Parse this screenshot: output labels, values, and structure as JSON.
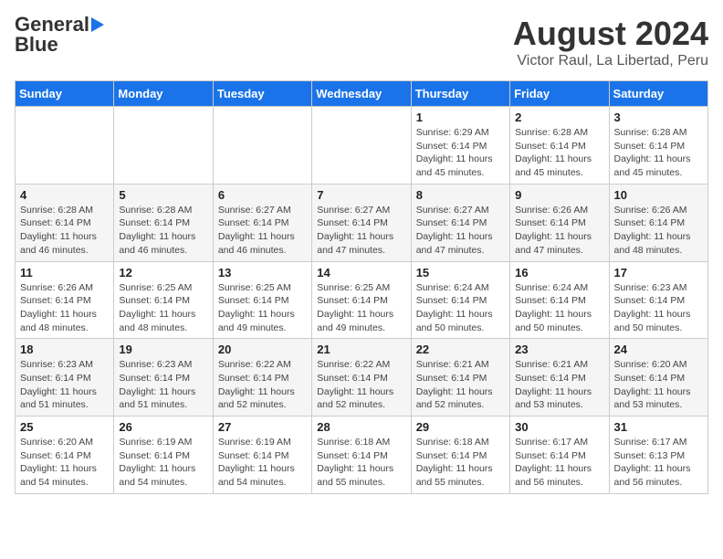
{
  "header": {
    "logo_general": "General",
    "logo_blue": "Blue",
    "month_year": "August 2024",
    "location": "Victor Raul, La Libertad, Peru"
  },
  "weekdays": [
    "Sunday",
    "Monday",
    "Tuesday",
    "Wednesday",
    "Thursday",
    "Friday",
    "Saturday"
  ],
  "weeks": [
    [
      {
        "day": "",
        "info": ""
      },
      {
        "day": "",
        "info": ""
      },
      {
        "day": "",
        "info": ""
      },
      {
        "day": "",
        "info": ""
      },
      {
        "day": "1",
        "info": "Sunrise: 6:29 AM\nSunset: 6:14 PM\nDaylight: 11 hours\nand 45 minutes."
      },
      {
        "day": "2",
        "info": "Sunrise: 6:28 AM\nSunset: 6:14 PM\nDaylight: 11 hours\nand 45 minutes."
      },
      {
        "day": "3",
        "info": "Sunrise: 6:28 AM\nSunset: 6:14 PM\nDaylight: 11 hours\nand 45 minutes."
      }
    ],
    [
      {
        "day": "4",
        "info": "Sunrise: 6:28 AM\nSunset: 6:14 PM\nDaylight: 11 hours\nand 46 minutes."
      },
      {
        "day": "5",
        "info": "Sunrise: 6:28 AM\nSunset: 6:14 PM\nDaylight: 11 hours\nand 46 minutes."
      },
      {
        "day": "6",
        "info": "Sunrise: 6:27 AM\nSunset: 6:14 PM\nDaylight: 11 hours\nand 46 minutes."
      },
      {
        "day": "7",
        "info": "Sunrise: 6:27 AM\nSunset: 6:14 PM\nDaylight: 11 hours\nand 47 minutes."
      },
      {
        "day": "8",
        "info": "Sunrise: 6:27 AM\nSunset: 6:14 PM\nDaylight: 11 hours\nand 47 minutes."
      },
      {
        "day": "9",
        "info": "Sunrise: 6:26 AM\nSunset: 6:14 PM\nDaylight: 11 hours\nand 47 minutes."
      },
      {
        "day": "10",
        "info": "Sunrise: 6:26 AM\nSunset: 6:14 PM\nDaylight: 11 hours\nand 48 minutes."
      }
    ],
    [
      {
        "day": "11",
        "info": "Sunrise: 6:26 AM\nSunset: 6:14 PM\nDaylight: 11 hours\nand 48 minutes."
      },
      {
        "day": "12",
        "info": "Sunrise: 6:25 AM\nSunset: 6:14 PM\nDaylight: 11 hours\nand 48 minutes."
      },
      {
        "day": "13",
        "info": "Sunrise: 6:25 AM\nSunset: 6:14 PM\nDaylight: 11 hours\nand 49 minutes."
      },
      {
        "day": "14",
        "info": "Sunrise: 6:25 AM\nSunset: 6:14 PM\nDaylight: 11 hours\nand 49 minutes."
      },
      {
        "day": "15",
        "info": "Sunrise: 6:24 AM\nSunset: 6:14 PM\nDaylight: 11 hours\nand 50 minutes."
      },
      {
        "day": "16",
        "info": "Sunrise: 6:24 AM\nSunset: 6:14 PM\nDaylight: 11 hours\nand 50 minutes."
      },
      {
        "day": "17",
        "info": "Sunrise: 6:23 AM\nSunset: 6:14 PM\nDaylight: 11 hours\nand 50 minutes."
      }
    ],
    [
      {
        "day": "18",
        "info": "Sunrise: 6:23 AM\nSunset: 6:14 PM\nDaylight: 11 hours\nand 51 minutes."
      },
      {
        "day": "19",
        "info": "Sunrise: 6:23 AM\nSunset: 6:14 PM\nDaylight: 11 hours\nand 51 minutes."
      },
      {
        "day": "20",
        "info": "Sunrise: 6:22 AM\nSunset: 6:14 PM\nDaylight: 11 hours\nand 52 minutes."
      },
      {
        "day": "21",
        "info": "Sunrise: 6:22 AM\nSunset: 6:14 PM\nDaylight: 11 hours\nand 52 minutes."
      },
      {
        "day": "22",
        "info": "Sunrise: 6:21 AM\nSunset: 6:14 PM\nDaylight: 11 hours\nand 52 minutes."
      },
      {
        "day": "23",
        "info": "Sunrise: 6:21 AM\nSunset: 6:14 PM\nDaylight: 11 hours\nand 53 minutes."
      },
      {
        "day": "24",
        "info": "Sunrise: 6:20 AM\nSunset: 6:14 PM\nDaylight: 11 hours\nand 53 minutes."
      }
    ],
    [
      {
        "day": "25",
        "info": "Sunrise: 6:20 AM\nSunset: 6:14 PM\nDaylight: 11 hours\nand 54 minutes."
      },
      {
        "day": "26",
        "info": "Sunrise: 6:19 AM\nSunset: 6:14 PM\nDaylight: 11 hours\nand 54 minutes."
      },
      {
        "day": "27",
        "info": "Sunrise: 6:19 AM\nSunset: 6:14 PM\nDaylight: 11 hours\nand 54 minutes."
      },
      {
        "day": "28",
        "info": "Sunrise: 6:18 AM\nSunset: 6:14 PM\nDaylight: 11 hours\nand 55 minutes."
      },
      {
        "day": "29",
        "info": "Sunrise: 6:18 AM\nSunset: 6:14 PM\nDaylight: 11 hours\nand 55 minutes."
      },
      {
        "day": "30",
        "info": "Sunrise: 6:17 AM\nSunset: 6:14 PM\nDaylight: 11 hours\nand 56 minutes."
      },
      {
        "day": "31",
        "info": "Sunrise: 6:17 AM\nSunset: 6:13 PM\nDaylight: 11 hours\nand 56 minutes."
      }
    ]
  ]
}
